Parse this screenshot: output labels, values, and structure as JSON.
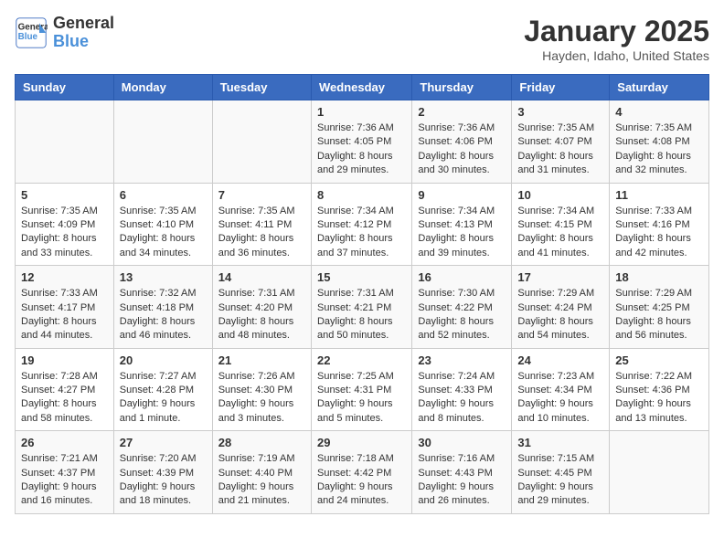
{
  "header": {
    "logo_line1": "General",
    "logo_line2": "Blue",
    "month": "January 2025",
    "location": "Hayden, Idaho, United States"
  },
  "weekdays": [
    "Sunday",
    "Monday",
    "Tuesday",
    "Wednesday",
    "Thursday",
    "Friday",
    "Saturday"
  ],
  "weeks": [
    [
      {
        "day": "",
        "info": ""
      },
      {
        "day": "",
        "info": ""
      },
      {
        "day": "",
        "info": ""
      },
      {
        "day": "1",
        "info": "Sunrise: 7:36 AM\nSunset: 4:05 PM\nDaylight: 8 hours and 29 minutes."
      },
      {
        "day": "2",
        "info": "Sunrise: 7:36 AM\nSunset: 4:06 PM\nDaylight: 8 hours and 30 minutes."
      },
      {
        "day": "3",
        "info": "Sunrise: 7:35 AM\nSunset: 4:07 PM\nDaylight: 8 hours and 31 minutes."
      },
      {
        "day": "4",
        "info": "Sunrise: 7:35 AM\nSunset: 4:08 PM\nDaylight: 8 hours and 32 minutes."
      }
    ],
    [
      {
        "day": "5",
        "info": "Sunrise: 7:35 AM\nSunset: 4:09 PM\nDaylight: 8 hours and 33 minutes."
      },
      {
        "day": "6",
        "info": "Sunrise: 7:35 AM\nSunset: 4:10 PM\nDaylight: 8 hours and 34 minutes."
      },
      {
        "day": "7",
        "info": "Sunrise: 7:35 AM\nSunset: 4:11 PM\nDaylight: 8 hours and 36 minutes."
      },
      {
        "day": "8",
        "info": "Sunrise: 7:34 AM\nSunset: 4:12 PM\nDaylight: 8 hours and 37 minutes."
      },
      {
        "day": "9",
        "info": "Sunrise: 7:34 AM\nSunset: 4:13 PM\nDaylight: 8 hours and 39 minutes."
      },
      {
        "day": "10",
        "info": "Sunrise: 7:34 AM\nSunset: 4:15 PM\nDaylight: 8 hours and 41 minutes."
      },
      {
        "day": "11",
        "info": "Sunrise: 7:33 AM\nSunset: 4:16 PM\nDaylight: 8 hours and 42 minutes."
      }
    ],
    [
      {
        "day": "12",
        "info": "Sunrise: 7:33 AM\nSunset: 4:17 PM\nDaylight: 8 hours and 44 minutes."
      },
      {
        "day": "13",
        "info": "Sunrise: 7:32 AM\nSunset: 4:18 PM\nDaylight: 8 hours and 46 minutes."
      },
      {
        "day": "14",
        "info": "Sunrise: 7:31 AM\nSunset: 4:20 PM\nDaylight: 8 hours and 48 minutes."
      },
      {
        "day": "15",
        "info": "Sunrise: 7:31 AM\nSunset: 4:21 PM\nDaylight: 8 hours and 50 minutes."
      },
      {
        "day": "16",
        "info": "Sunrise: 7:30 AM\nSunset: 4:22 PM\nDaylight: 8 hours and 52 minutes."
      },
      {
        "day": "17",
        "info": "Sunrise: 7:29 AM\nSunset: 4:24 PM\nDaylight: 8 hours and 54 minutes."
      },
      {
        "day": "18",
        "info": "Sunrise: 7:29 AM\nSunset: 4:25 PM\nDaylight: 8 hours and 56 minutes."
      }
    ],
    [
      {
        "day": "19",
        "info": "Sunrise: 7:28 AM\nSunset: 4:27 PM\nDaylight: 8 hours and 58 minutes."
      },
      {
        "day": "20",
        "info": "Sunrise: 7:27 AM\nSunset: 4:28 PM\nDaylight: 9 hours and 1 minute."
      },
      {
        "day": "21",
        "info": "Sunrise: 7:26 AM\nSunset: 4:30 PM\nDaylight: 9 hours and 3 minutes."
      },
      {
        "day": "22",
        "info": "Sunrise: 7:25 AM\nSunset: 4:31 PM\nDaylight: 9 hours and 5 minutes."
      },
      {
        "day": "23",
        "info": "Sunrise: 7:24 AM\nSunset: 4:33 PM\nDaylight: 9 hours and 8 minutes."
      },
      {
        "day": "24",
        "info": "Sunrise: 7:23 AM\nSunset: 4:34 PM\nDaylight: 9 hours and 10 minutes."
      },
      {
        "day": "25",
        "info": "Sunrise: 7:22 AM\nSunset: 4:36 PM\nDaylight: 9 hours and 13 minutes."
      }
    ],
    [
      {
        "day": "26",
        "info": "Sunrise: 7:21 AM\nSunset: 4:37 PM\nDaylight: 9 hours and 16 minutes."
      },
      {
        "day": "27",
        "info": "Sunrise: 7:20 AM\nSunset: 4:39 PM\nDaylight: 9 hours and 18 minutes."
      },
      {
        "day": "28",
        "info": "Sunrise: 7:19 AM\nSunset: 4:40 PM\nDaylight: 9 hours and 21 minutes."
      },
      {
        "day": "29",
        "info": "Sunrise: 7:18 AM\nSunset: 4:42 PM\nDaylight: 9 hours and 24 minutes."
      },
      {
        "day": "30",
        "info": "Sunrise: 7:16 AM\nSunset: 4:43 PM\nDaylight: 9 hours and 26 minutes."
      },
      {
        "day": "31",
        "info": "Sunrise: 7:15 AM\nSunset: 4:45 PM\nDaylight: 9 hours and 29 minutes."
      },
      {
        "day": "",
        "info": ""
      }
    ]
  ]
}
